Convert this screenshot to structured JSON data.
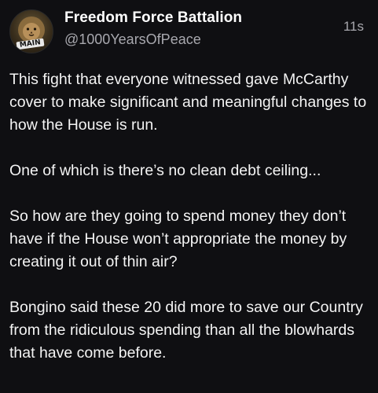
{
  "post": {
    "author_name": "Freedom Force Battalion",
    "author_handle": "@1000YearsOfPeace",
    "timestamp": "11s",
    "avatar_label": "MAIN",
    "paragraphs": [
      "This fight that everyone witnessed gave McCarthy cover to make significant and meaningful changes to how the House is run.",
      "One of which is there’s no clean debt ceiling...",
      "So how are they going to spend money they don’t have if the House won’t appropriate the money by creating it out of thin air?",
      "Bongino said these 20 did more to save our Country from the ridiculous spending than all the blowhards that have come before."
    ]
  },
  "colors": {
    "background": "#0f0f12",
    "text_primary": "#f4f4f4",
    "text_secondary": "#a8a8ae"
  }
}
